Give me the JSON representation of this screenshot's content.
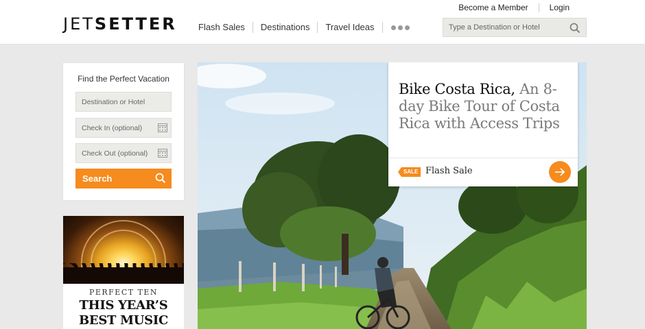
{
  "brand": {
    "logo_light": "JET",
    "logo_bold": "SETTER",
    "accent": "#f68b1e"
  },
  "nav": {
    "items": [
      "Flash Sales",
      "Destinations",
      "Travel Ideas"
    ],
    "more_icon": "ellipsis-icon"
  },
  "top_links": {
    "member": "Become a Member",
    "login": "Login"
  },
  "header_search": {
    "placeholder": "Type a Destination or Hotel",
    "icon": "search-icon"
  },
  "search_panel": {
    "title": "Find the Perfect Vacation",
    "destination_placeholder": "Destination or Hotel",
    "checkin_placeholder": "Check In (optional)",
    "checkout_placeholder": "Check Out (optional)",
    "button_label": "Search"
  },
  "promo": {
    "kicker": "PERFECT TEN",
    "title": "THIS YEAR’S BEST MUSIC FESTS"
  },
  "feature": {
    "title_strong": "Bike Costa Rica,",
    "title_rest": " An 8-day Bike Tour of Costa Rica with Access Trips",
    "sale_badge": "SALE",
    "label": "Flash Sale"
  }
}
